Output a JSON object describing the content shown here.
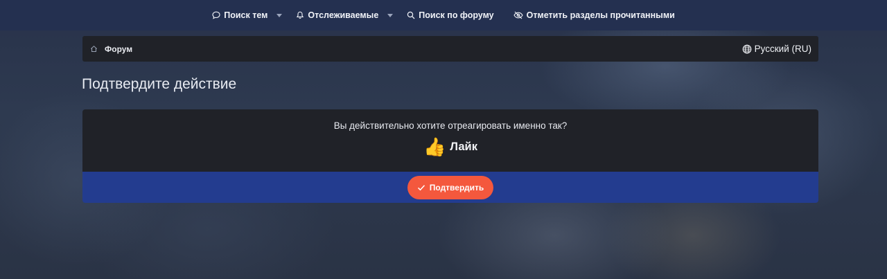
{
  "nav": {
    "items": [
      {
        "label": "Поиск тем",
        "icon": "chat-bubble-icon",
        "dropdown": true
      },
      {
        "label": "Отслеживаемые",
        "icon": "bell-icon",
        "dropdown": true
      },
      {
        "label": "Поиск по форуму",
        "icon": "search-icon",
        "dropdown": false
      },
      {
        "label": "Отметить разделы прочитанными",
        "icon": "eye-slash-icon",
        "dropdown": false
      }
    ]
  },
  "breadcrumb": {
    "home_icon": "home-icon",
    "item": "Форум",
    "language": "Русский (RU)",
    "language_icon": "globe-icon"
  },
  "page": {
    "title": "Подтвердите действие"
  },
  "dialog": {
    "question": "Вы действительно хотите отреагировать именно так?",
    "reaction_emoji": "👍",
    "reaction_label": "Лайк",
    "confirm_label": "Подтвердить",
    "confirm_icon": "check-icon"
  },
  "colors": {
    "nav_bg": "#243050",
    "panel_bg": "#202228",
    "footer_bg": "#233c8f",
    "button_bg": "#f4583d"
  }
}
